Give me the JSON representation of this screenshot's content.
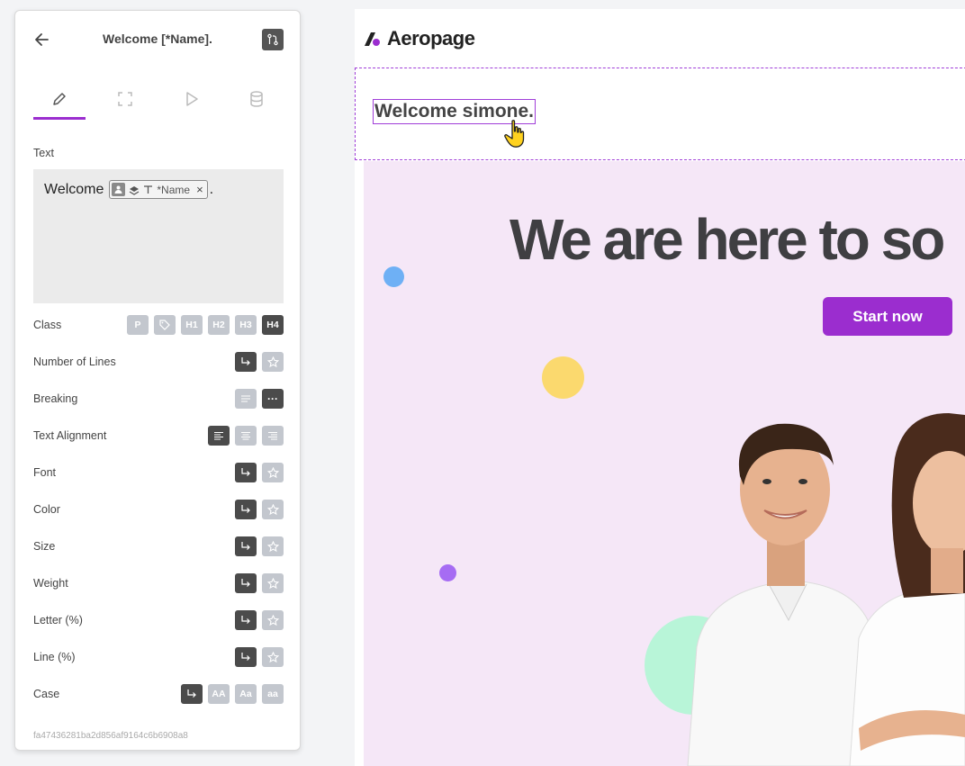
{
  "panel": {
    "title": "Welcome [*Name].",
    "text_label": "Text",
    "editor": {
      "prefix": "Welcome",
      "chip_label": "*Name",
      "suffix": "."
    },
    "rows": [
      {
        "label": "Class",
        "buttons": [
          "P",
          "tag",
          "H1",
          "H2",
          "H3",
          "H4"
        ],
        "active": "H4"
      },
      {
        "label": "Number of Lines"
      },
      {
        "label": "Breaking"
      },
      {
        "label": "Text Alignment"
      },
      {
        "label": "Font"
      },
      {
        "label": "Color"
      },
      {
        "label": "Size"
      },
      {
        "label": "Weight"
      },
      {
        "label": "Letter (%)"
      },
      {
        "label": "Line (%)"
      },
      {
        "label": "Case",
        "buttons": [
          "AA",
          "Aa",
          "aa"
        ]
      }
    ],
    "hash": "fa47436281ba2d856af9164c6b6908a8"
  },
  "preview": {
    "logo": "Aeropage",
    "welcome_text": "Welcome simone.",
    "hero_title": "We are here to so",
    "cta_label": "Start now"
  },
  "colors": {
    "accent": "#9b2dcf",
    "hero_bg": "#f5e7f7",
    "dark_btn": "#4b4b4b",
    "light_btn": "#c3c7ce"
  }
}
